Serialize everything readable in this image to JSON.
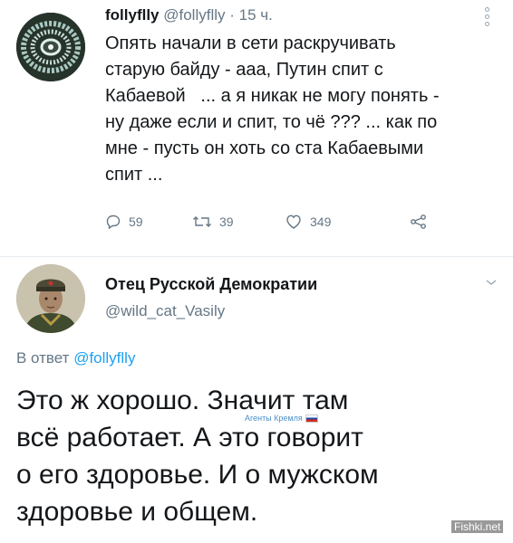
{
  "tweet1": {
    "display_name": "follyflly",
    "handle": "@follyflly",
    "separator": "·",
    "time": "15 ч.",
    "text": "Опять начали в сети раскручивать\nстарую байду - ааа, Путин спит с\nКабаевой   ... а я никак не могу понять -\nну даже если и спит, то чё ??? ... как по\nмне - пусть он хоть со ста Кабаевыми\nспит ...",
    "actions": {
      "replies": "59",
      "retweets": "39",
      "likes": "349"
    }
  },
  "tweet2": {
    "display_name": "Отец Русской Демократии",
    "handle": "@wild_cat_Vasily",
    "reply_prefix": "В ответ",
    "reply_to": "@follyflly",
    "text": "Это ж хорошо. Значит там\nвсё работает. А это говорит\nо его здоровье. И о мужском\nздоровье и общем."
  },
  "watermarks": {
    "agents": "Агенты Кремля",
    "site": "Fishki.net"
  },
  "colors": {
    "text": "#14171a",
    "muted": "#657786",
    "link": "#1da1f2",
    "divider": "#e6ecf0"
  },
  "icons": [
    "more-dots-icon",
    "reply-icon",
    "retweet-icon",
    "like-icon",
    "share-icon",
    "chevron-down-icon",
    "russian-flag-icon"
  ]
}
